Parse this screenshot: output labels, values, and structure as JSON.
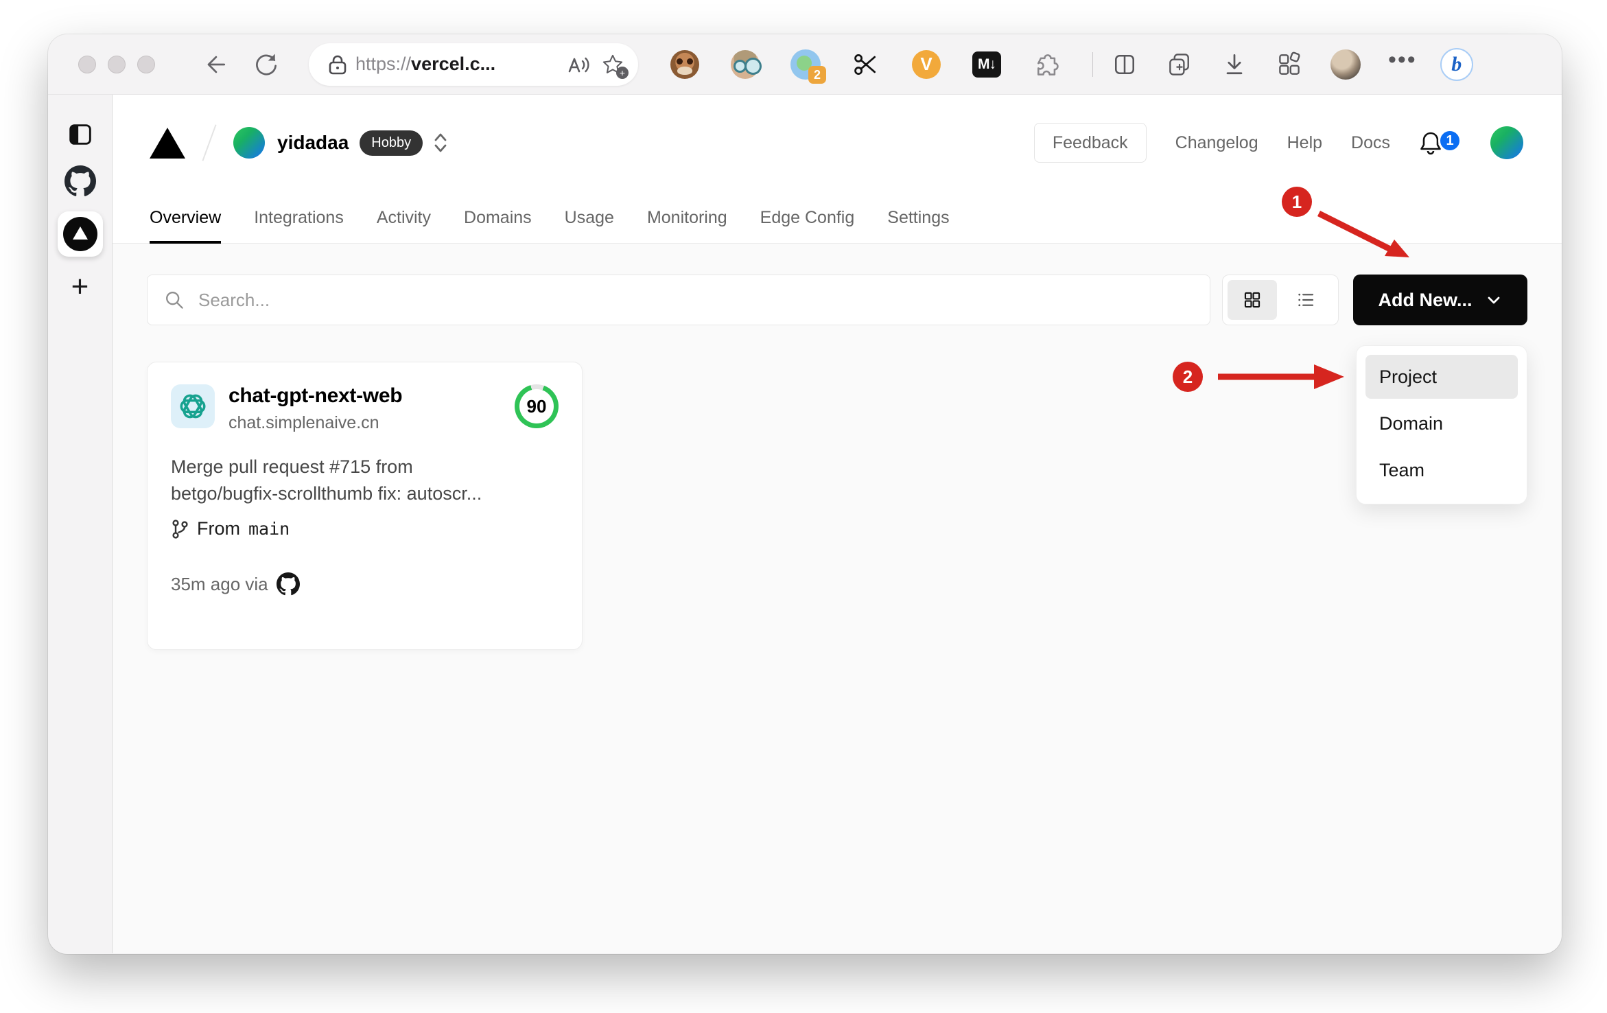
{
  "browser": {
    "url": {
      "scheme": "https://",
      "host": "vercel.c..."
    },
    "translate_badge": "2",
    "markdown_label": "M↓",
    "voice_label": "V",
    "bing_letter": "b",
    "more_glyph": "•••",
    "new_tab_glyph": "+"
  },
  "header": {
    "team_name": "yidadaa",
    "plan_badge": "Hobby",
    "feedback_label": "Feedback",
    "changelog_label": "Changelog",
    "help_label": "Help",
    "docs_label": "Docs",
    "notification_count": "1"
  },
  "tabs": [
    {
      "label": "Overview"
    },
    {
      "label": "Integrations"
    },
    {
      "label": "Activity"
    },
    {
      "label": "Domains"
    },
    {
      "label": "Usage"
    },
    {
      "label": "Monitoring"
    },
    {
      "label": "Edge Config"
    },
    {
      "label": "Settings"
    }
  ],
  "content": {
    "search_placeholder": "Search...",
    "add_new_label": "Add New...",
    "dropdown": {
      "items": [
        {
          "label": "Project"
        },
        {
          "label": "Domain"
        },
        {
          "label": "Team"
        }
      ]
    },
    "project_card": {
      "name": "chat-gpt-next-web",
      "domain": "chat.simplenaive.cn",
      "score": "90",
      "commit_lines": [
        "Merge pull request #715 from",
        "betgo/bugfix-scrollthumb fix: autoscr..."
      ],
      "branch_label": "From",
      "branch_name": "main",
      "meta": "35m ago via"
    }
  },
  "annotations": {
    "step1": "1",
    "step2": "2"
  },
  "colors": {
    "annotation_red": "#d6251f",
    "score_green": "#2fc356",
    "notification_blue": "#0b6ef3",
    "add_new_black": "#0a0a0a",
    "content_bg": "#fafafa"
  }
}
